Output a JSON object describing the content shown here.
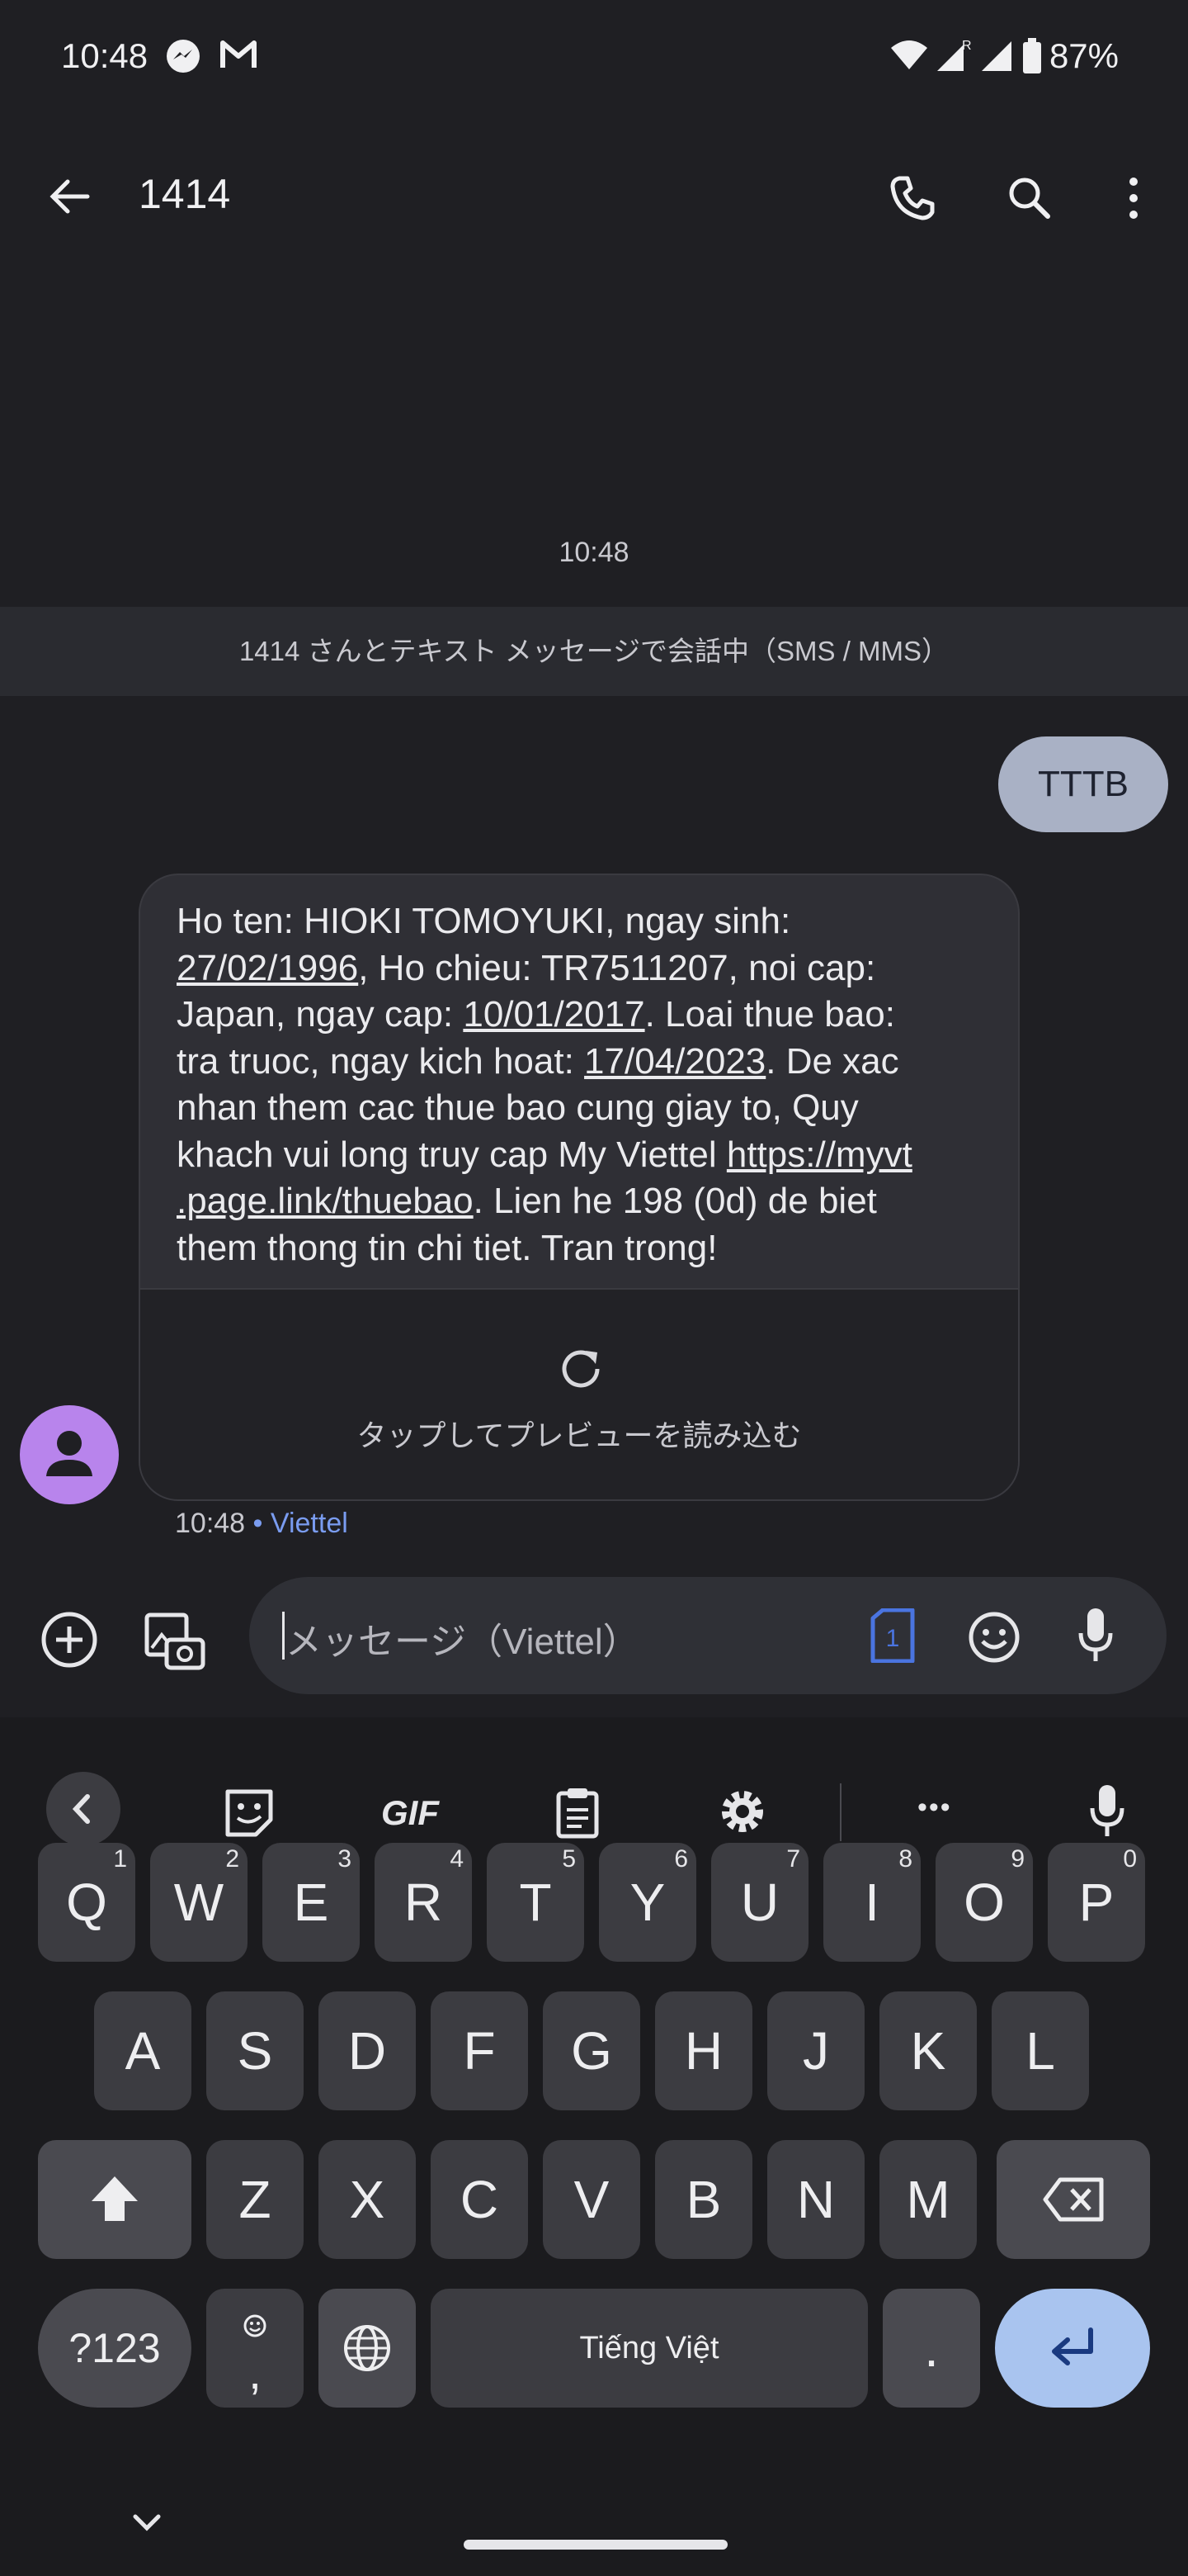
{
  "status_bar": {
    "time": "10:48",
    "battery": "87%"
  },
  "app_bar": {
    "title": "1414"
  },
  "conversation": {
    "timestamp": "10:48",
    "banner": "1414 さんとテキスト メッセージで会話中（SMS / MMS）",
    "outgoing": "TTTB",
    "incoming": {
      "lines": [
        "Ho ten: HIOKI TOMOYUKI, ngay sinh:",
        "27/02/1996",
        ", Ho chieu: TR7511207, noi cap:",
        "Japan, ngay cap: ",
        "10/01/2017",
        ". Loai thue bao:",
        "tra truoc, ngay kich hoat: ",
        "17/04/2023",
        ". De xac",
        "nhan them cac thue bao cung giay to, Quy",
        "khach vui long truy cap My Viettel ",
        "https://myvt",
        ".page.link/thuebao",
        ". Lien he 198 (0d) de biet",
        "them thong tin chi tiet. Tran trong!"
      ],
      "preview_label": "タップしてプレビューを読み込む"
    },
    "meta_time": "10:48",
    "meta_carrier": "Viettel"
  },
  "compose": {
    "placeholder": "メッセージ（Viettel）",
    "sim_badge": "1"
  },
  "keyboard": {
    "toolbar": {
      "gif": "GIF",
      "more": "•••"
    },
    "row1": [
      {
        "label": "Q",
        "hint": "1"
      },
      {
        "label": "W",
        "hint": "2"
      },
      {
        "label": "E",
        "hint": "3"
      },
      {
        "label": "R",
        "hint": "4"
      },
      {
        "label": "T",
        "hint": "5"
      },
      {
        "label": "Y",
        "hint": "6"
      },
      {
        "label": "U",
        "hint": "7"
      },
      {
        "label": "I",
        "hint": "8"
      },
      {
        "label": "O",
        "hint": "9"
      },
      {
        "label": "P",
        "hint": "0"
      }
    ],
    "row2": [
      "A",
      "S",
      "D",
      "F",
      "G",
      "H",
      "J",
      "K",
      "L"
    ],
    "row3": [
      "Z",
      "X",
      "C",
      "V",
      "B",
      "N",
      "M"
    ],
    "symbols": "?123",
    "comma": ",",
    "space": "Tiếng Việt",
    "period": "."
  },
  "colors": {
    "background": "#1f1f23",
    "outgoing_bubble": "#a9b1c5",
    "avatar": "#b884ec",
    "accent": "#7a9cf0",
    "enter_key": "#a9c4ef"
  }
}
